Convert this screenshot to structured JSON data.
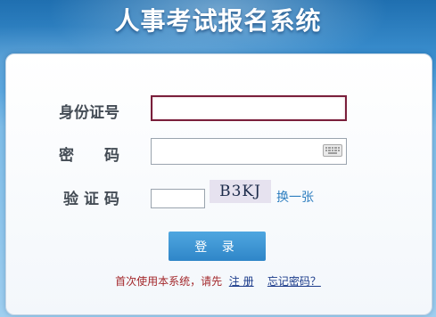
{
  "header": {
    "title": "人事考试报名系统"
  },
  "form": {
    "id_label": "身份证号",
    "id_value": "",
    "password_label": "密　　码",
    "password_value": "",
    "captcha_label": "验 证 码",
    "captcha_value": "",
    "captcha_text": "B3KJ",
    "refresh_label": "换一张",
    "login_label": "登 录",
    "keyboard_icon": "keyboard-icon"
  },
  "footer": {
    "hint": "首次使用本系统，请先",
    "register_label": "注 册",
    "forgot_label": "忘记密码？"
  },
  "colors": {
    "accent": "#2f86c8",
    "focus_border": "#7a1f3b",
    "hint": "#a3272b",
    "link": "#1a3a8a"
  }
}
